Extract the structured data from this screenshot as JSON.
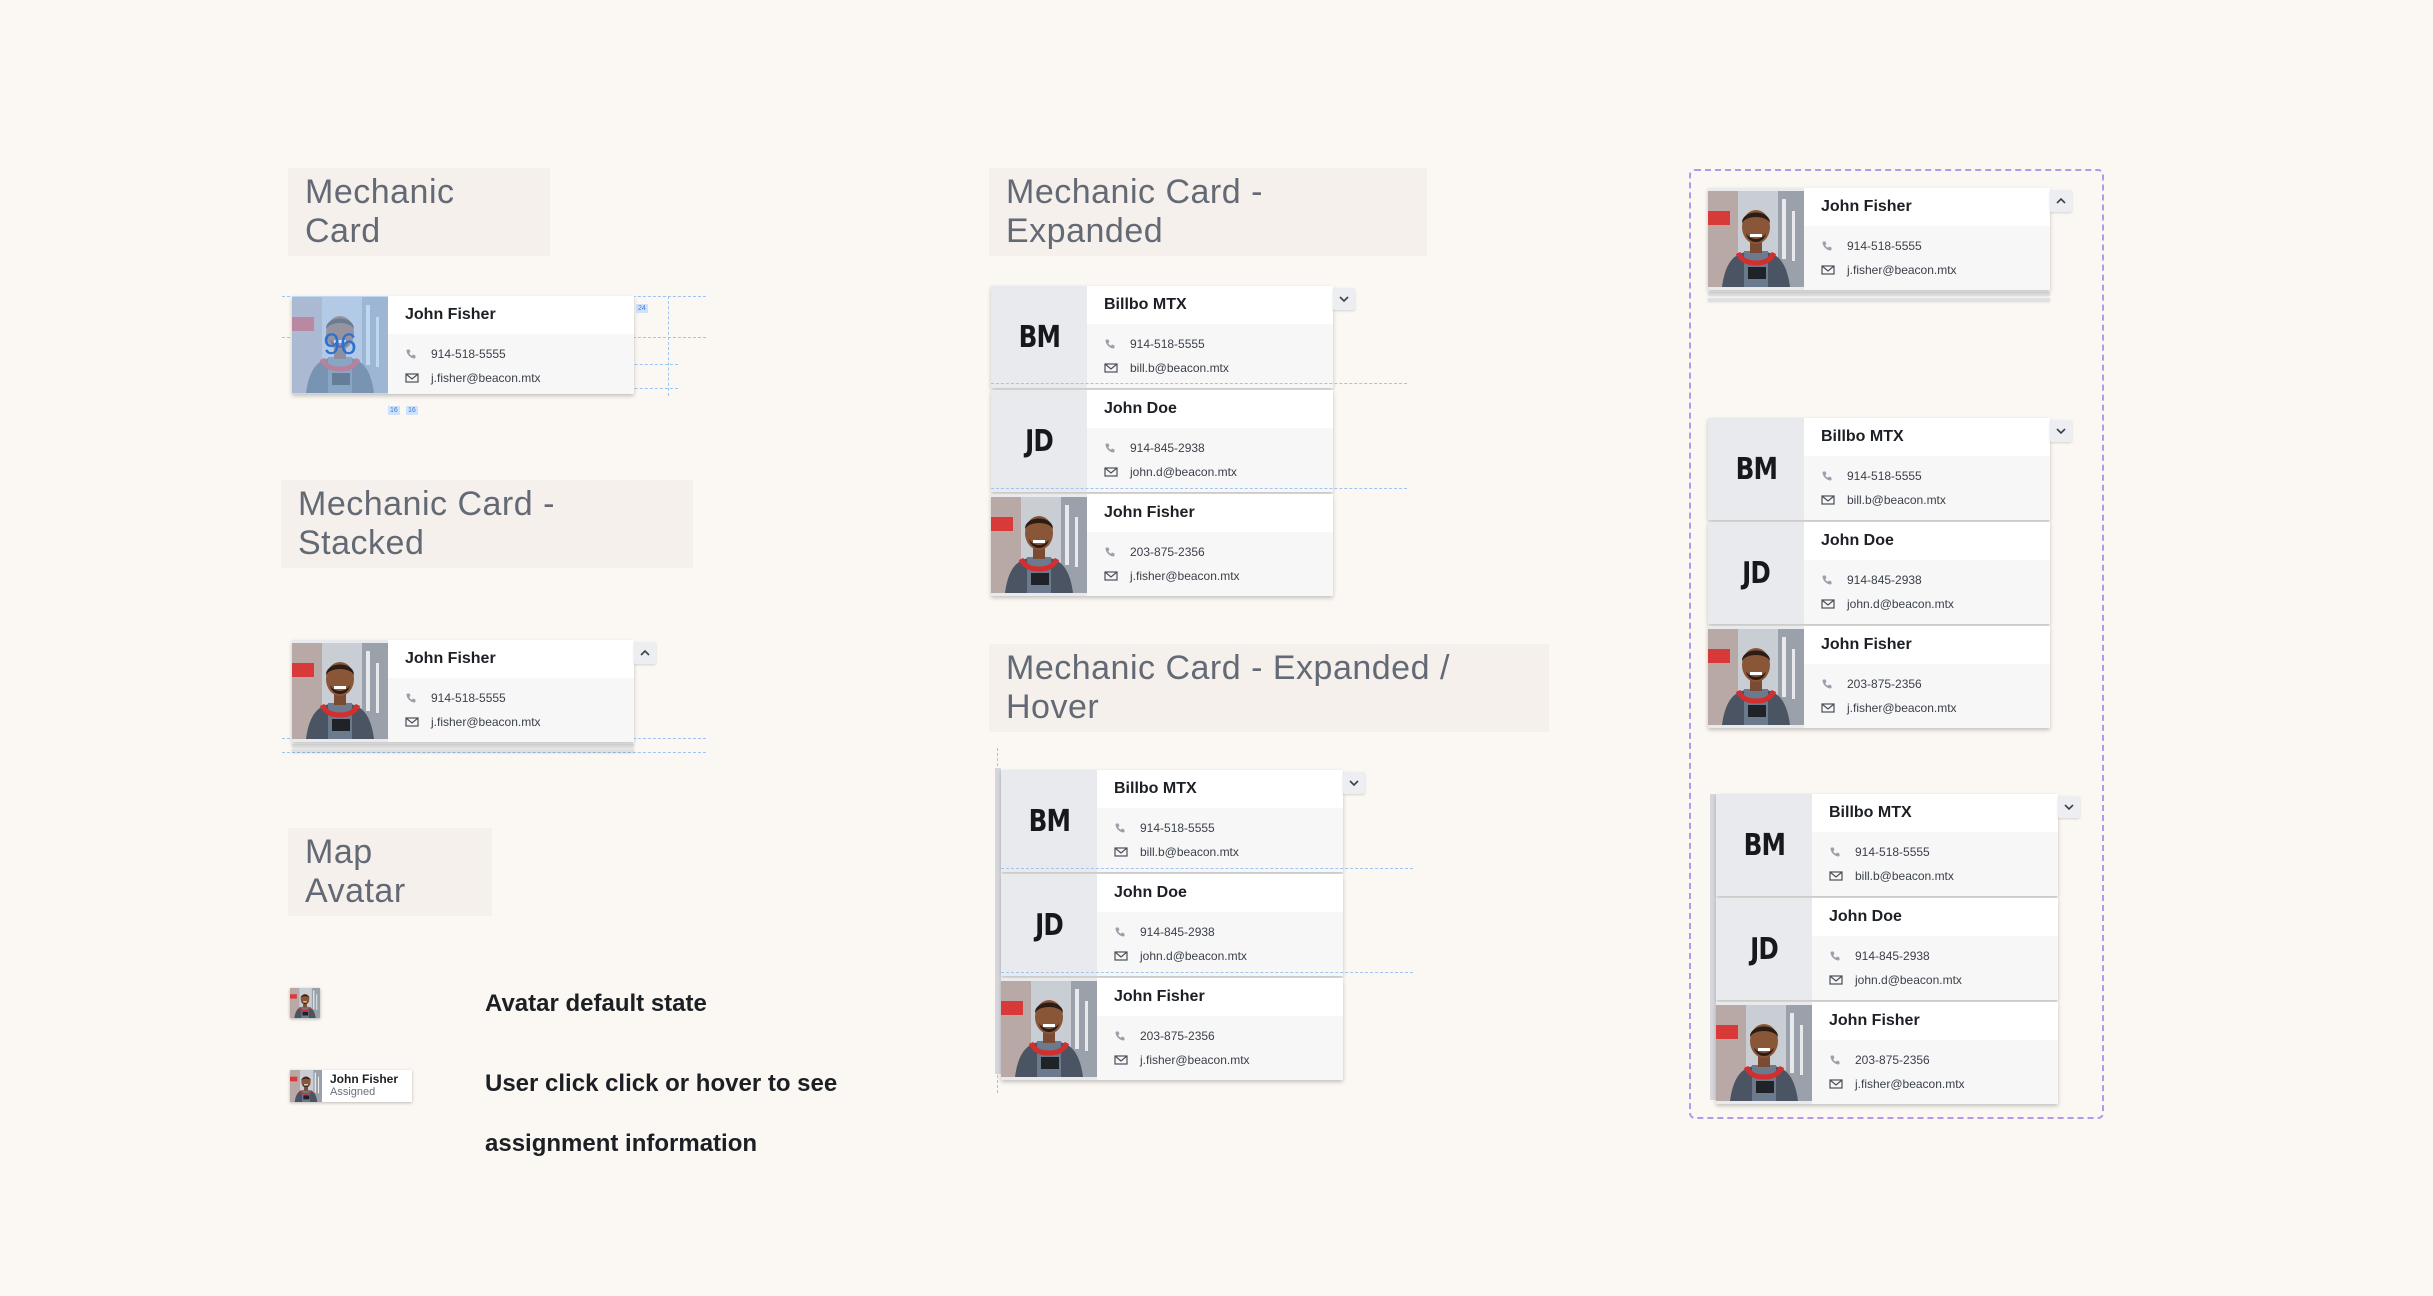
{
  "titles": {
    "mechanic_card": "Mechanic Card",
    "stacked": "Mechanic Card - Stacked",
    "map_avatar": "Map Avatar",
    "expanded": "Mechanic Card - Expanded",
    "expanded_hover": "Mechanic Card - Expanded / Hover"
  },
  "mechanics": {
    "billbo": {
      "initials": "BM",
      "name": "Billbo MTX",
      "phone": "914-518-5555",
      "email": "bill.b@beacon.mtx"
    },
    "john_doe": {
      "initials": "JD",
      "name": "John Doe",
      "phone": "914-845-2938",
      "email": "john.d@beacon.mtx"
    },
    "john_fisher_single": {
      "name": "John Fisher",
      "phone": "914-518-5555",
      "email": "j.fisher@beacon.mtx"
    },
    "john_fisher_stack": {
      "name": "John Fisher",
      "phone": "203-875-2356",
      "email": "j.fisher@beacon.mtx"
    }
  },
  "measure": {
    "avatar_size": "96",
    "tags": [
      "24",
      "16",
      "16"
    ]
  },
  "map_avatar": {
    "default_label": "Avatar default state",
    "click_label_line1": "User click click or hover to see",
    "click_label_line2": "assignment information",
    "assign_name": "John Fisher",
    "assign_status": "Assigned"
  },
  "icons": {
    "phone": "phone-icon",
    "email": "mail-icon",
    "chevron_up": "chevron-up-icon",
    "chevron_down": "chevron-down-icon"
  },
  "colors": {
    "background": "#fbf7f2",
    "title_bg": "#f5f0eb",
    "title_text": "#636a75",
    "avatar_bg": "#e9eaee",
    "guide": "#9ec5f2",
    "frame": "#b499ea"
  }
}
